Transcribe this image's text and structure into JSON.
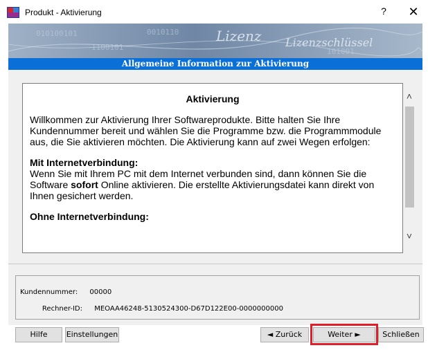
{
  "window": {
    "title": "Produkt - Aktivierung",
    "help_glyph": "?",
    "close_glyph": "✕"
  },
  "banner": {
    "text_1": "Lizenz",
    "text_2": "Lizenzschlüssel"
  },
  "section_header": "Allgemeine Information zur Aktivierung",
  "document": {
    "title": "Aktivierung",
    "intro": "Willkommen zur Aktivierung Ihrer Softwareprodukte. Bitte halten Sie Ihre Kundennummer bereit und wählen Sie die Programme bzw. die Programmmodule aus, die Sie aktivieren möchten. Die Aktivierung kann auf zwei Wegen erfolgen:",
    "section_online": {
      "heading": "Mit Internetverbindung:",
      "text_before": "Wenn Sie mit Ihrem PC mit dem Internet verbunden sind, dann können Sie die Software ",
      "text_bold": "sofort",
      "text_after": " Online aktivieren. Die erstellte Aktivierungsdatei kann direkt von Ihnen gesichert werden."
    },
    "section_offline": {
      "heading": "Ohne Internetverbindung:"
    }
  },
  "scrollbar": {
    "up_glyph": "˄",
    "down_glyph": "˅"
  },
  "info": {
    "customer_label": "Kundennummer:",
    "customer_value": "00000",
    "machine_label": "Rechner-ID:",
    "machine_value": "MEOAA46248-5130524300-D67D122E00-0000000000"
  },
  "buttons": {
    "help": "Hilfe",
    "settings": "Einstellungen",
    "back": "◄ Zurück",
    "next": "Weiter ►",
    "close": "Schließen"
  },
  "colors": {
    "header_blue": "#0a6fd6",
    "highlight_red": "#e11d2a",
    "dialog_gray": "#f0f0f0"
  }
}
